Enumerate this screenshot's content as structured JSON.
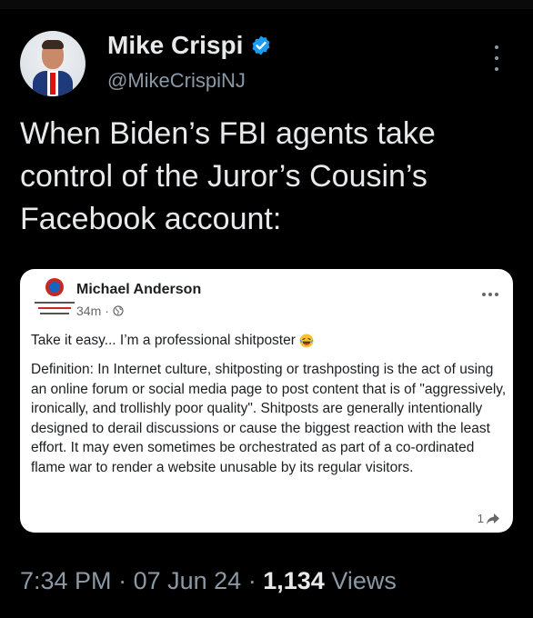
{
  "tweet": {
    "author": {
      "display_name": "Mike Crispi",
      "handle": "@MikeCrispiNJ",
      "verified": true
    },
    "text": "When Biden’s FBI agents take control of the Juror’s Cousin’s Facebook account:",
    "time": "7:34 PM",
    "date": "07 Jun 24",
    "views_count": "1,134",
    "views_label": "Views",
    "separator": "·"
  },
  "fb_post": {
    "author": "Michael Anderson",
    "time_ago": "34m",
    "meta_sep": "·",
    "line1": "Take it easy... I’m a professional shitposter",
    "body": "Definition: In Internet culture, shitposting or trashposting is the act of using an online forum or social media page to post content that is of \"aggressively, ironically, and trollishly poor quality\". Shitposts are generally intentionally designed to derail discussions or cause the biggest reaction with the least effort. It may even sometimes be orchestrated as part of a co-ordinated flame war to render a website unusable by its regular visitors.",
    "share_count": "1"
  },
  "colors": {
    "background": "#000000",
    "text": "#e7e9ea",
    "muted": "#8b98a5",
    "verified": "#1d9bf0",
    "card": "#ffffff"
  },
  "icons": [
    "verified-badge-icon",
    "more-vertical-icon",
    "globe-icon",
    "laughing-emoji-icon",
    "share-arrow-icon",
    "more-horizontal-icon"
  ]
}
